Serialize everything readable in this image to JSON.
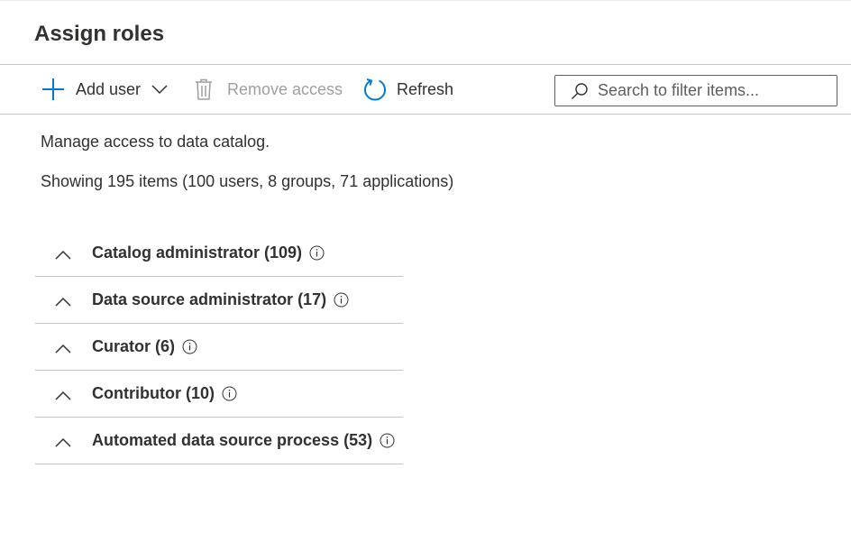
{
  "page": {
    "title": "Assign roles"
  },
  "toolbar": {
    "add_user_label": "Add user",
    "remove_access_label": "Remove access",
    "refresh_label": "Refresh",
    "search_placeholder": "Search to filter items..."
  },
  "content": {
    "description": "Manage access to data catalog.",
    "summary": "Showing 195 items (100 users, 8 groups, 71 applications)"
  },
  "roles": [
    {
      "label": "Catalog administrator (109)"
    },
    {
      "label": "Data source administrator (17)"
    },
    {
      "label": "Curator (6)"
    },
    {
      "label": "Contributor (10)"
    },
    {
      "label": "Automated data source process (53)"
    }
  ],
  "icons": {
    "add": "plus-icon",
    "dropdown": "chevron-down-icon",
    "remove": "trash-icon",
    "refresh": "refresh-icon",
    "search": "search-icon",
    "collapse": "chevron-up-icon",
    "info": "info-icon"
  },
  "colors": {
    "accent": "#0078d4",
    "text": "#323130",
    "disabled": "#a19f9d",
    "border": "#c8c6c4"
  }
}
